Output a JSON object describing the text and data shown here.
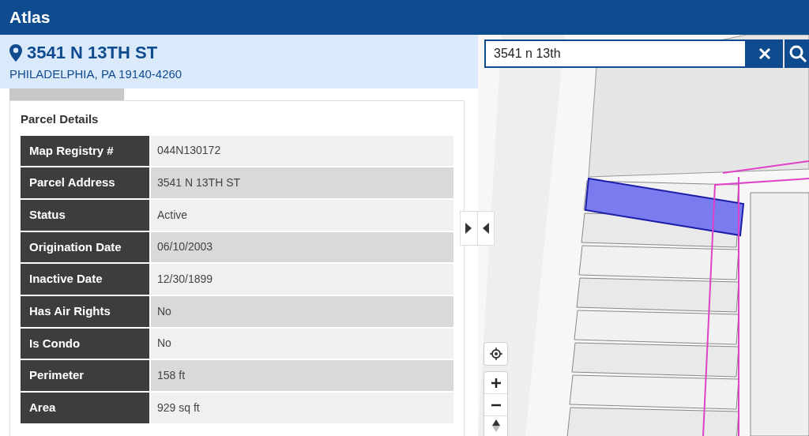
{
  "app_title": "Atlas",
  "location": {
    "address": "3541 N 13TH ST",
    "city_line": "PHILADELPHIA, PA 19140-4260"
  },
  "parcel_details": {
    "title": "Parcel Details",
    "rows": [
      {
        "label": "Map Registry #",
        "value": "044N130172"
      },
      {
        "label": "Parcel Address",
        "value": "3541 N 13TH ST"
      },
      {
        "label": "Status",
        "value": "Active"
      },
      {
        "label": "Origination Date",
        "value": "06/10/2003"
      },
      {
        "label": "Inactive Date",
        "value": "12/30/1899"
      },
      {
        "label": "Has Air Rights",
        "value": "No"
      },
      {
        "label": "Is Condo",
        "value": "No"
      },
      {
        "label": "Perimeter",
        "value": "158 ft"
      },
      {
        "label": "Area",
        "value": "929 sq ft"
      }
    ]
  },
  "map": {
    "kind": "picture",
    "search": {
      "value": "3541 n 13th"
    }
  }
}
